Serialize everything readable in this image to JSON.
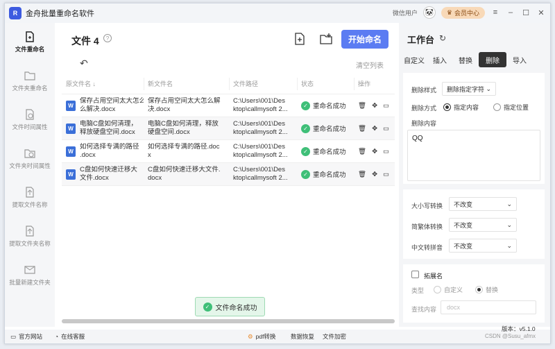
{
  "app": {
    "title": "金舟批量重命名软件",
    "user_label": "微信用户",
    "vip_label": "会员中心"
  },
  "sidebar": {
    "items": [
      {
        "label": "文件重命名",
        "icon": "file-rename-icon"
      },
      {
        "label": "文件夹重命名",
        "icon": "folder-rename-icon"
      },
      {
        "label": "文件时间属性",
        "icon": "file-time-icon"
      },
      {
        "label": "文件夹时间属性",
        "icon": "folder-time-icon"
      },
      {
        "label": "提取文件名称",
        "icon": "extract-file-icon"
      },
      {
        "label": "提取文件夹名称",
        "icon": "extract-folder-icon"
      },
      {
        "label": "批量新建文件夹",
        "icon": "new-folder-icon"
      }
    ]
  },
  "main": {
    "title": "文件 4",
    "start_button": "开始命名",
    "clear_list": "清空列表",
    "columns": [
      "原文件名 ↓",
      "新文件名",
      "文件路径",
      "状态",
      "操作"
    ],
    "rows": [
      {
        "orig": [
          "保存占用空间太大怎么",
          "么解决.docx"
        ],
        "new": [
          "保存占用空间太大怎么解",
          "决.docx"
        ],
        "path": [
          "C:\\Users\\001\\Des",
          "ktop\\callmysoft 2..."
        ],
        "status": "重命名成功"
      },
      {
        "orig": [
          "电脑C盘如何清理，",
          "释放硬盘空间.docx"
        ],
        "new": [
          "电脑C盘如何清理，释放",
          "硬盘空间.docx"
        ],
        "path": [
          "C:\\Users\\001\\Des",
          "ktop\\callmysoft 2..."
        ],
        "status": "重命名成功"
      },
      {
        "orig": [
          "如何选择专满的路径",
          ".docx"
        ],
        "new": [
          "如何选择专满的路径.doc",
          "x"
        ],
        "path": [
          "C:\\Users\\001\\Des",
          "ktop\\callmysoft 2..."
        ],
        "status": "重命名成功"
      },
      {
        "orig": [
          "C盘如何快速迁移大",
          "文件.docx"
        ],
        "new": [
          "C盘如何快速迁移大文件.",
          "docx"
        ],
        "path": [
          "C:\\Users\\001\\Des",
          "ktop\\callmysoft 2..."
        ],
        "status": "重命名成功"
      }
    ],
    "toast": "文件命名成功"
  },
  "panel": {
    "title": "工作台",
    "tabs": [
      "自定义",
      "插入",
      "替换",
      "删除",
      "导入"
    ],
    "active_tab": "删除",
    "delete_style_label": "删除样式",
    "delete_style_value": "删除指定字符",
    "delete_mode_label": "删除方式",
    "mode_options": [
      "指定内容",
      "指定位置"
    ],
    "delete_content_label": "删除内容",
    "delete_content_value": "QQ",
    "case_label": "大小写转换",
    "case_value": "不改变",
    "trad_label": "简繁体转换",
    "trad_value": "不改变",
    "pinyin_label": "中文转拼音",
    "pinyin_value": "不改变",
    "ext_label": "拓展名",
    "type_label": "类型",
    "type_options": [
      "自定义",
      "替换"
    ],
    "find_label": "查找内容",
    "find_placeholder": "docx"
  },
  "statusbar": {
    "website": "官方网站",
    "service": "在线客服",
    "pdf": "pdf转换",
    "recover": "数据恢复",
    "encrypt": "文件加密",
    "version": "版本：v5.1.0",
    "watermark": "CSDN @Susu_afmx"
  }
}
